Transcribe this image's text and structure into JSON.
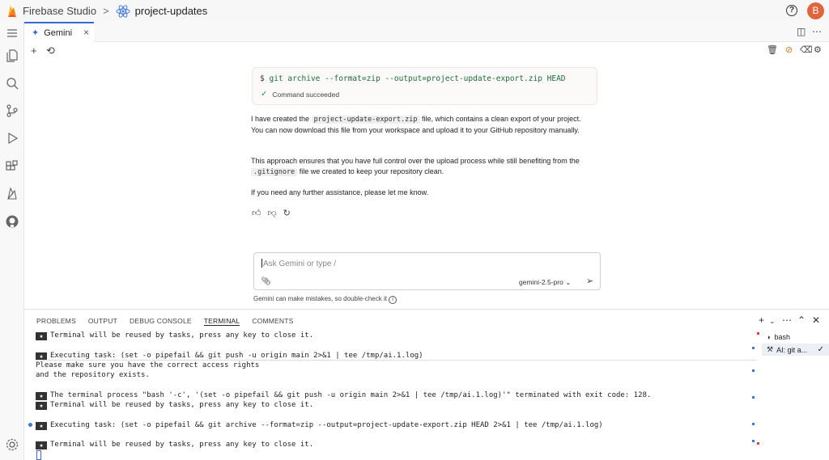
{
  "topbar": {
    "app_name": "Firebase Studio",
    "separator": ">",
    "project_name": "project-updates",
    "help_icon": "help-circle-icon",
    "avatar_letter": "B",
    "avatar_color": "#e0653c"
  },
  "editor": {
    "tab_label": "Gemini",
    "tab_close": "×",
    "split_icon": "split-editor-icon",
    "more_icon": "more-horizontal-icon"
  },
  "gemini": {
    "command": {
      "prompt": "$",
      "text": "git archive --format=zip --output=project-update-export.zip HEAD",
      "status": "Command succeeded"
    },
    "message": {
      "p1_before": "I have created the ",
      "p1_code": "project-update-export.zip",
      "p1_after": " file, which contains a clean export of your project. You can now download this file from your workspace and upload it to your GitHub repository manually.",
      "p2_before": "This approach ensures that you have full control over the upload process while still benefiting from the ",
      "p2_code": ".gitignore",
      "p2_after": " file we created to keep your repository clean.",
      "p3": "If you need any further assistance, please let me know."
    },
    "input": {
      "placeholder": "Ask Gemini or type /",
      "model": "gemini-2.5-pro",
      "model_chevron": "⌄",
      "disclaimer": "Gemini can make mistakes, so double-check it",
      "info": "i"
    }
  },
  "bottom": {
    "tabs": [
      "PROBLEMS",
      "OUTPUT",
      "DEBUG CONSOLE",
      "TERMINAL",
      "COMMENTS"
    ],
    "active_tab": "TERMINAL",
    "terminal_lines": [
      {
        "star": true,
        "text": "Terminal will be reused by tasks, press any key to close it."
      },
      {
        "star": false,
        "text": ""
      },
      {
        "star": true,
        "text": "Executing task: (set -o pipefail && git push -u origin main 2>&1 | tee /tmp/ai.1.log)"
      },
      {
        "star": false,
        "text": "Please make sure you have the correct access rights"
      },
      {
        "star": false,
        "text": "and the repository exists."
      },
      {
        "star": false,
        "text": ""
      },
      {
        "star": true,
        "text": "The terminal process \"bash '-c', '(set -o pipefail && git push -u origin main 2>&1 | tee /tmp/ai.1.log)'\" terminated with exit code: 128."
      },
      {
        "star": true,
        "text": "Terminal will be reused by tasks, press any key to close it."
      },
      {
        "star": false,
        "text": ""
      },
      {
        "star": true,
        "text": "Executing task: (set -o pipefail && git archive --format=zip --output=project-update-export.zip HEAD 2>&1 | tee /tmp/ai.1.log)"
      },
      {
        "star": false,
        "text": ""
      },
      {
        "star": true,
        "text": "Terminal will be reused by tasks, press any key to close it."
      }
    ],
    "terminals": [
      {
        "label": "bash",
        "selected": false
      },
      {
        "label": "AI: git a...",
        "selected": true
      }
    ]
  },
  "colors": {
    "accent": "#3a66d6",
    "success": "#2e8b57",
    "firebase_orange": "#f4811f"
  }
}
